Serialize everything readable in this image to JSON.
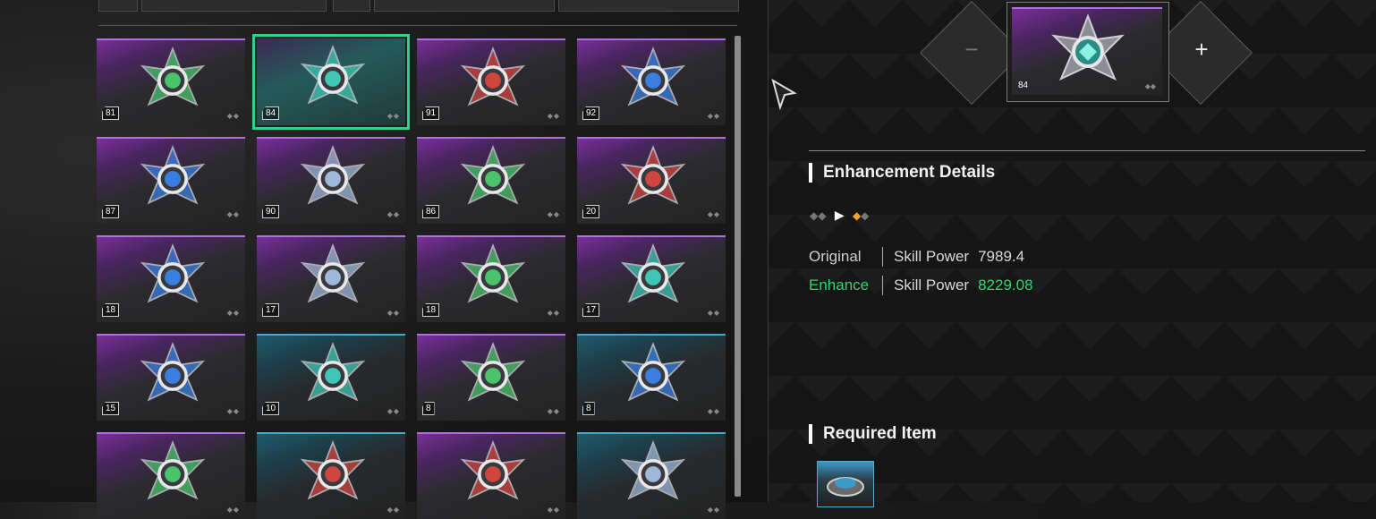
{
  "inventory": {
    "modules": [
      {
        "level": "81",
        "color": "green",
        "rarity": "purple"
      },
      {
        "level": "84",
        "color": "teal",
        "rarity": "purple",
        "selected": true
      },
      {
        "level": "91",
        "color": "red",
        "rarity": "purple"
      },
      {
        "level": "92",
        "color": "blue",
        "rarity": "purple"
      },
      {
        "level": "87",
        "color": "blue",
        "rarity": "purple"
      },
      {
        "level": "90",
        "color": "silver",
        "rarity": "purple"
      },
      {
        "level": "86",
        "color": "green",
        "rarity": "purple"
      },
      {
        "level": "20",
        "color": "red",
        "rarity": "purple"
      },
      {
        "level": "18",
        "color": "blue",
        "rarity": "purple"
      },
      {
        "level": "17",
        "color": "silver",
        "rarity": "purple"
      },
      {
        "level": "18",
        "color": "green",
        "rarity": "purple"
      },
      {
        "level": "17",
        "color": "teal",
        "rarity": "purple"
      },
      {
        "level": "15",
        "color": "blue",
        "rarity": "purple"
      },
      {
        "level": "10",
        "color": "teal",
        "rarity": "teal"
      },
      {
        "level": "8",
        "color": "green",
        "rarity": "purple"
      },
      {
        "level": "8",
        "color": "blue",
        "rarity": "teal"
      },
      {
        "level": "",
        "color": "green",
        "rarity": "purple"
      },
      {
        "level": "",
        "color": "red",
        "rarity": "teal"
      },
      {
        "level": "",
        "color": "red",
        "rarity": "purple"
      },
      {
        "level": "",
        "color": "silver",
        "rarity": "teal"
      }
    ],
    "pips": "◆◆"
  },
  "enhance": {
    "minus": "−",
    "plus": "+",
    "selected_level": "84",
    "pips": "◆◆"
  },
  "details": {
    "title": "Enhancement Details",
    "stage_before": "◆◆",
    "stage_arrow": "▶",
    "stage_after_gold": "◆",
    "stage_after_grey": "◆",
    "original_label": "Original",
    "enhance_label": "Enhance",
    "stat_name": "Skill Power",
    "original_value": "7989.4",
    "enhance_value": "8229.08"
  },
  "required": {
    "title": "Required Item"
  },
  "colors": {
    "green": "#49c46a",
    "teal": "#3fc6b4",
    "red": "#d0453e",
    "blue": "#3a7fe0",
    "silver": "#9fb7d8",
    "accent": "#2fd570",
    "gold": "#f2a71b"
  }
}
